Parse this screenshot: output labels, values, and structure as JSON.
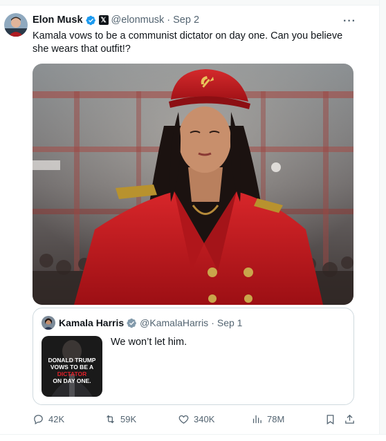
{
  "tweet": {
    "author_name": "Elon Musk",
    "author_handle": "@elonmusk",
    "separator": "·",
    "date": "Sep 2",
    "more_label": "···",
    "text": "Kamala vows to be a communist dictator on day one. Can you believe she wears that outfit!?"
  },
  "quoted_tweet": {
    "author_name": "Kamala Harris",
    "author_handle": "@KamalaHarris",
    "separator": "·",
    "date": "Sep 1",
    "text": "We won’t let him.",
    "thumbnail_text": {
      "line1": "DONALD TRUMP",
      "line2": "VOWS TO BE A",
      "line3": "DICTATOR",
      "line4": "ON DAY ONE."
    }
  },
  "actions": {
    "replies": "42K",
    "reposts": "59K",
    "likes": "340K",
    "views": "78M"
  },
  "colors": {
    "verified_blue": "#1d9bf0",
    "secondary_text": "#536471",
    "border": "#cfd9de",
    "coat_red": "#c0141b"
  },
  "icons": [
    "verified-badge-icon",
    "x-affiliate-icon",
    "more-icon",
    "reply-icon",
    "repost-icon",
    "like-icon",
    "views-icon",
    "bookmark-icon",
    "share-icon"
  ]
}
